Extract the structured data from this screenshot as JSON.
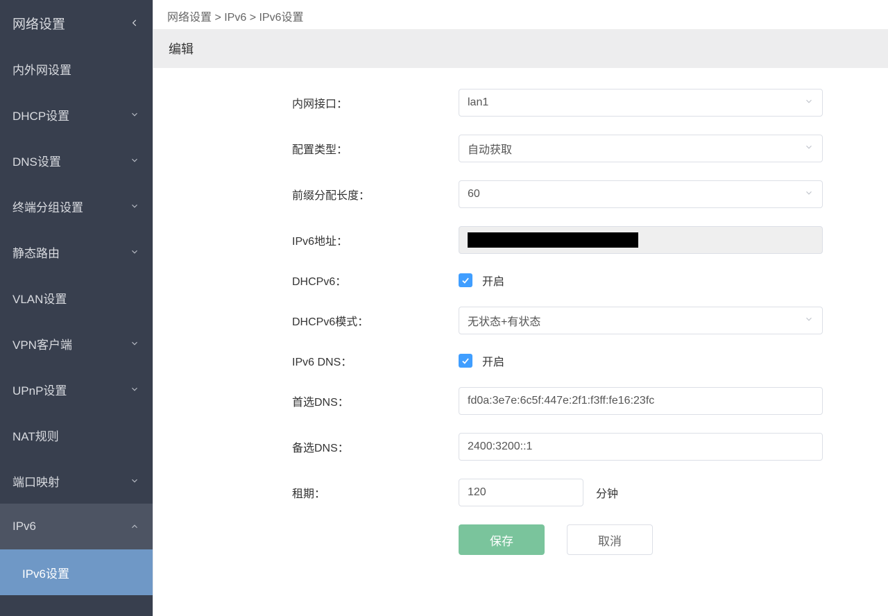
{
  "sidebar": {
    "title": "网络设置",
    "items": [
      {
        "label": "内外网设置",
        "expandable": false
      },
      {
        "label": "DHCP设置",
        "expandable": true
      },
      {
        "label": "DNS设置",
        "expandable": true
      },
      {
        "label": "终端分组设置",
        "expandable": true
      },
      {
        "label": "静态路由",
        "expandable": true
      },
      {
        "label": "VLAN设置",
        "expandable": false
      },
      {
        "label": "VPN客户端",
        "expandable": true
      },
      {
        "label": "UPnP设置",
        "expandable": true
      },
      {
        "label": "NAT规则",
        "expandable": false
      },
      {
        "label": "端口映射",
        "expandable": true
      },
      {
        "label": "IPv6",
        "expandable": true,
        "expanded": true,
        "sub": [
          {
            "label": "IPv6设置"
          }
        ]
      }
    ]
  },
  "breadcrumb": "网络设置 > IPv6 > IPv6设置",
  "section_title": "编辑",
  "form": {
    "lan_iface": {
      "label": "内网接口：",
      "value": "lan1"
    },
    "cfg_type": {
      "label": "配置类型：",
      "value": "自动获取"
    },
    "prefix_len": {
      "label": "前缀分配长度：",
      "value": "60"
    },
    "ipv6_addr": {
      "label": "IPv6地址：",
      "value": ""
    },
    "dhcpv6": {
      "label": "DHCPv6：",
      "checked": true,
      "check_label": "开启"
    },
    "dhcpv6_mode": {
      "label": "DHCPv6模式：",
      "value": "无状态+有状态"
    },
    "ipv6_dns": {
      "label": "IPv6 DNS：",
      "checked": true,
      "check_label": "开启"
    },
    "dns1": {
      "label": "首选DNS：",
      "value": "fd0a:3e7e:6c5f:447e:2f1:f3ff:fe16:23fc"
    },
    "dns2": {
      "label": "备选DNS：",
      "value": "2400:3200::1"
    },
    "lease": {
      "label": "租期：",
      "value": "120",
      "unit": "分钟"
    }
  },
  "actions": {
    "save": "保存",
    "cancel": "取消"
  }
}
